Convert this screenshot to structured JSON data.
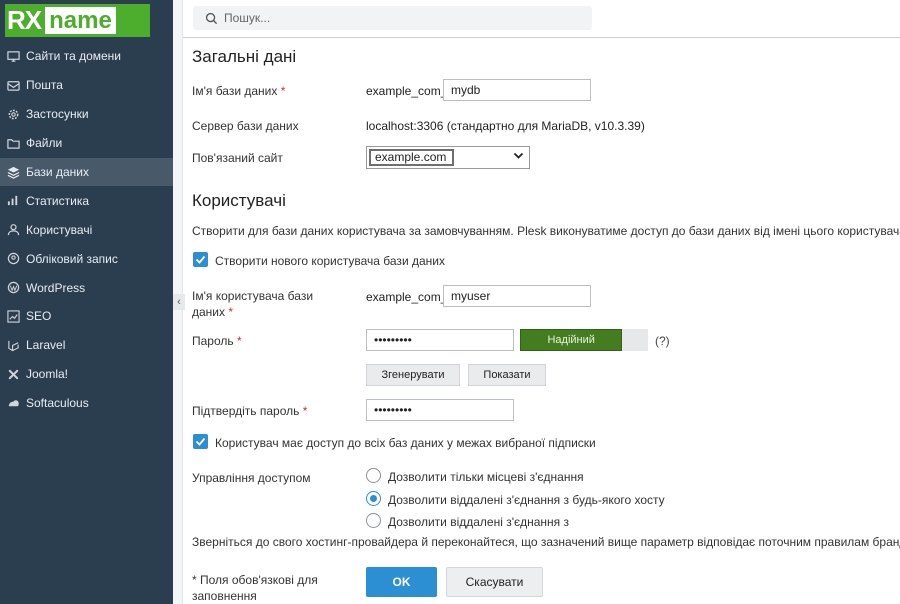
{
  "brand": {
    "logo_rx": "RX",
    "logo_name": "name",
    "accent": "#4cae2c"
  },
  "sidebar": {
    "items": [
      {
        "label": "Сайти та домени",
        "icon": "monitor-icon"
      },
      {
        "label": "Пошта",
        "icon": "mail-icon"
      },
      {
        "label": "Застосунки",
        "icon": "gear-icon"
      },
      {
        "label": "Файли",
        "icon": "folder-icon"
      },
      {
        "label": "Бази даних",
        "icon": "database-icon",
        "active": true
      },
      {
        "label": "Статистика",
        "icon": "chart-icon"
      },
      {
        "label": "Користувачі",
        "icon": "user-icon"
      },
      {
        "label": "Обліковий запис",
        "icon": "account-icon"
      },
      {
        "label": "WordPress",
        "icon": "wordpress-icon"
      },
      {
        "label": "SEO",
        "icon": "seo-icon"
      },
      {
        "label": "Laravel",
        "icon": "laravel-icon"
      },
      {
        "label": "Joomla!",
        "icon": "joomla-icon"
      },
      {
        "label": "Softaculous",
        "icon": "softaculous-icon"
      }
    ],
    "collapse_glyph": "‹"
  },
  "search": {
    "placeholder": "Пошук..."
  },
  "general": {
    "title": "Загальні дані",
    "db_name_label": "Ім'я бази даних",
    "db_prefix": "example_com_",
    "db_name_value": "mydb",
    "server_label": "Сервер бази даних",
    "server_value": "localhost:3306 (стандартно для MariaDB, v10.3.39)",
    "site_label": "Пов'язаний сайт",
    "site_value": "example.com"
  },
  "users": {
    "title": "Користувачі",
    "description": "Створити для бази даних користувача за замовчуванням. Plesk виконуватиме доступ до бази даних від імені цього користувача.",
    "create_user_label": "Створити нового користувача бази даних",
    "username_label_1": "Ім'я користувача бази",
    "username_label_2": "даних",
    "user_prefix": "example_com_",
    "username_value": "myuser",
    "password_label": "Пароль",
    "password_value": "•••••••••",
    "strength_label": "Надійний",
    "strength_fraction": 0.8,
    "help_label": "(?)",
    "generate_label": "Згенерувати",
    "show_label": "Показати",
    "confirm_label": "Підтвердіть пароль",
    "confirm_value": "•••••••••",
    "access_all_label": "Користувач має доступ до всіх баз даних у межах вибраної підписки",
    "access_control_label": "Управління доступом",
    "access_options": [
      {
        "label": "Дозволити тільки місцеві з'єднання",
        "selected": false
      },
      {
        "label": "Дозволити віддалені з'єднання з будь-якого хосту",
        "selected": true
      },
      {
        "label": "Дозволити віддалені з'єднання з",
        "selected": false
      }
    ],
    "note": "Зверніться до свого хостинг-провайдера й переконайтеся, що зазначений вище параметр відповідає поточним правилам бранд"
  },
  "footer": {
    "required_note_1": "* Поля обов'язкові для",
    "required_note_2": "заповнення",
    "ok_label": "OK",
    "cancel_label": "Скасувати"
  },
  "required_mark": "*"
}
